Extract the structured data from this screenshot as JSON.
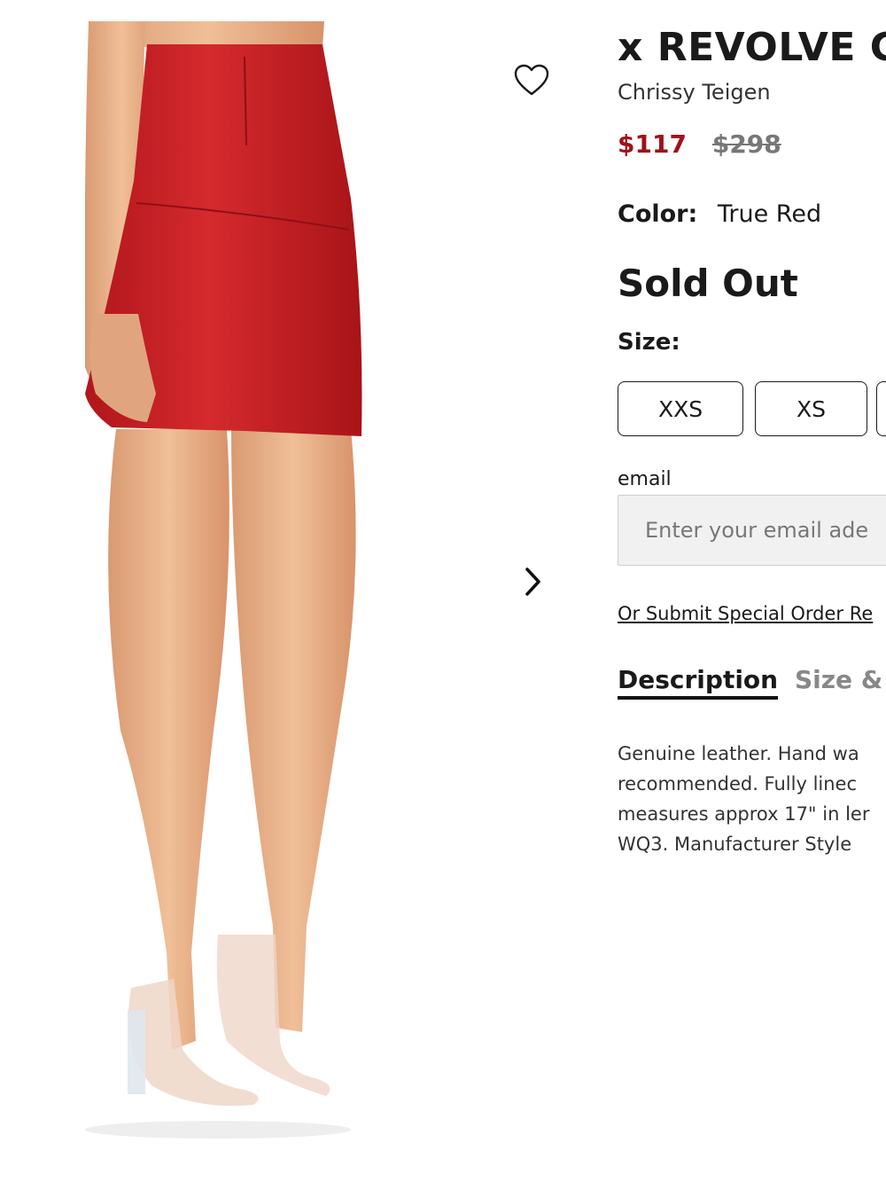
{
  "product": {
    "title": "x REVOLVE G",
    "brand": "Chrissy Teigen",
    "sale_price": "$117",
    "original_price": "$298",
    "color_label": "Color:",
    "color_value": "True Red",
    "status": "Sold Out",
    "size_label": "Size:",
    "sizes": [
      "XXS",
      "XS"
    ]
  },
  "email": {
    "label": "email",
    "placeholder": "Enter your email ade"
  },
  "special_order_link": "Or Submit Special Order Re",
  "tabs": [
    "Description",
    "Size &"
  ],
  "description_lines": [
    "Genuine leather. Hand wa",
    "recommended. Fully linec",
    "measures approx 17\" in ler",
    "WQ3. Manufacturer Style"
  ],
  "icons": {
    "wishlist": "heart-outline-icon",
    "next": "chevron-right-icon"
  },
  "colors": {
    "sale_price": "#a0111b",
    "skirt": "#c01f24",
    "text": "#1a1a1a"
  }
}
